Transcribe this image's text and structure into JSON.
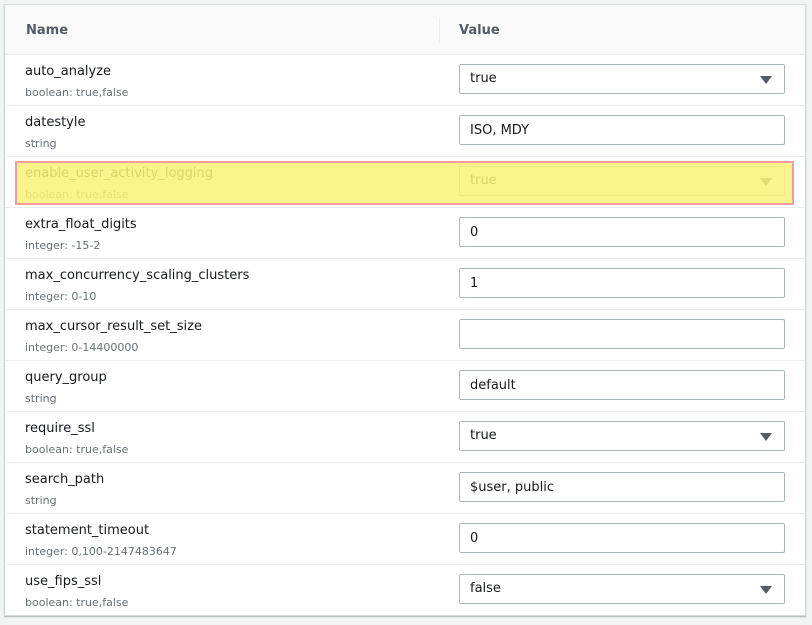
{
  "table": {
    "headers": {
      "name": "Name",
      "value": "Value"
    },
    "rows": [
      {
        "name": "auto_analyze",
        "type": "boolean: true,false",
        "control": "select",
        "value": "true"
      },
      {
        "name": "datestyle",
        "type": "string",
        "control": "text",
        "value": "ISO, MDY"
      },
      {
        "name": "enable_user_activity_logging",
        "type": "boolean: true,false",
        "control": "select",
        "value": "true",
        "highlighted": true
      },
      {
        "name": "extra_float_digits",
        "type": "integer: -15-2",
        "control": "text",
        "value": "0"
      },
      {
        "name": "max_concurrency_scaling_clusters",
        "type": "integer: 0-10",
        "control": "text",
        "value": "1"
      },
      {
        "name": "max_cursor_result_set_size",
        "type": "integer: 0-14400000",
        "control": "text",
        "value": ""
      },
      {
        "name": "query_group",
        "type": "string",
        "control": "text",
        "value": "default"
      },
      {
        "name": "require_ssl",
        "type": "boolean: true,false",
        "control": "select",
        "value": "true"
      },
      {
        "name": "search_path",
        "type": "string",
        "control": "text",
        "value": "$user, public"
      },
      {
        "name": "statement_timeout",
        "type": "integer: 0,100-2147483647",
        "control": "text",
        "value": "0"
      },
      {
        "name": "use_fips_ssl",
        "type": "boolean: true,false",
        "control": "select",
        "value": "false"
      }
    ]
  },
  "icons": {
    "dropdown": "caret-down-icon"
  },
  "colors": {
    "highlight": "#fbf37a",
    "highlight_border": "#f08b8b"
  }
}
